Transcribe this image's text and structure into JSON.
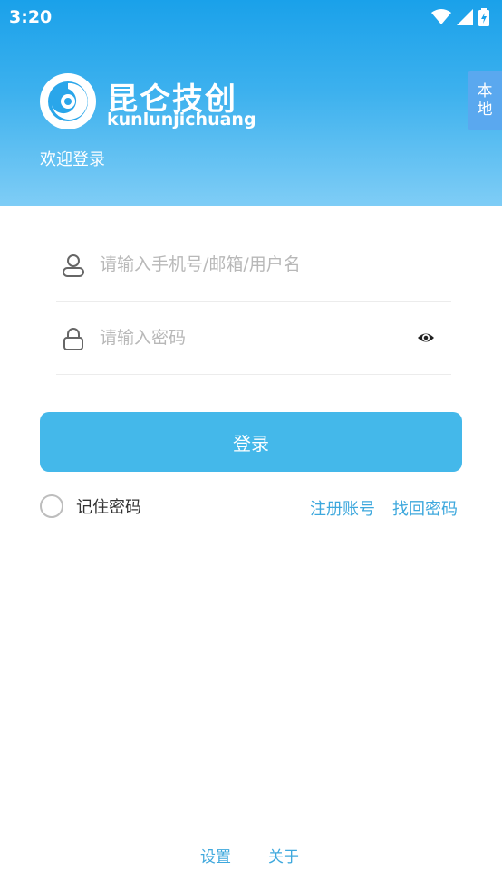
{
  "status_bar": {
    "time": "3:20",
    "icons": [
      "wifi-icon",
      "signal-icon",
      "battery-icon"
    ]
  },
  "header": {
    "brand_name": "昆仑技创",
    "brand_pinyin": "kunlunjichuang",
    "welcome": "欢迎登录",
    "local_label": "本地"
  },
  "form": {
    "username_placeholder": "请输入手机号/邮箱/用户名",
    "username_value": "",
    "password_placeholder": "请输入密码",
    "password_value": "",
    "login_label": "登录",
    "remember_label": "记住密码",
    "remember_checked": false,
    "register_label": "注册账号",
    "recover_label": "找回密码"
  },
  "footer": {
    "settings_label": "设置",
    "about_label": "关于"
  },
  "colors": {
    "header_top": "#1aa1ea",
    "header_bottom": "#7fcdf6",
    "accent": "#44b8ea",
    "link": "#3ea8dd"
  }
}
